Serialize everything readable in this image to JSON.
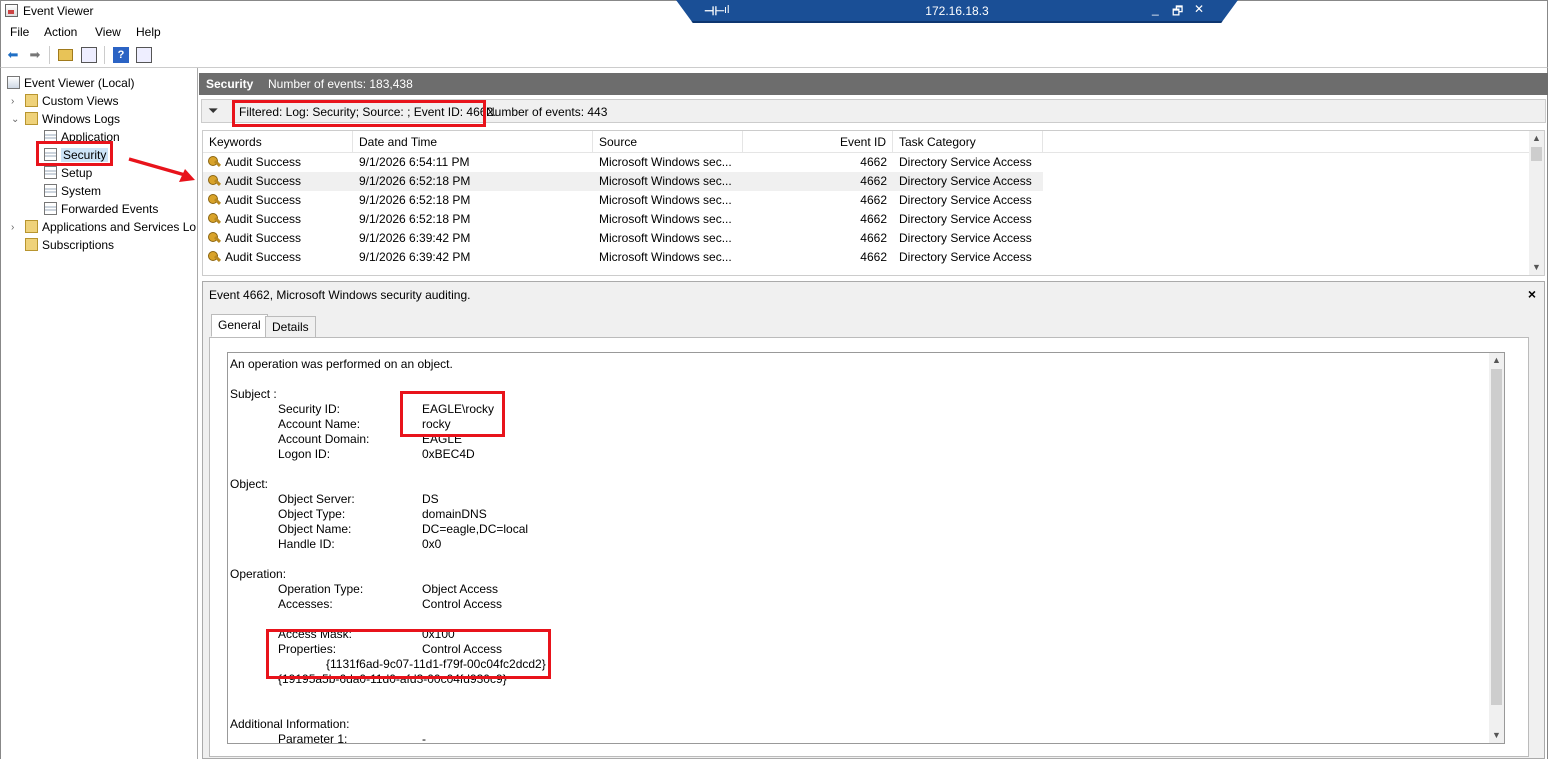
{
  "window": {
    "title": "Event Viewer"
  },
  "rdp": {
    "host": "172.16.18.3",
    "pin": "⊣⊢",
    "signal": "ıl",
    "minimize": "_",
    "restore": "🗗",
    "close": "✕"
  },
  "menu": [
    "File",
    "Action",
    "View",
    "Help"
  ],
  "tree": {
    "root": "Event Viewer (Local)",
    "custom_views": "Custom Views",
    "windows_logs": "Windows Logs",
    "application": "Application",
    "security": "Security",
    "setup": "Setup",
    "system": "System",
    "forwarded": "Forwarded Events",
    "apps_services": "Applications and Services Lo",
    "subscriptions": "Subscriptions"
  },
  "log_header": {
    "title": "Security",
    "count": "Number of events: 183,438"
  },
  "filter": {
    "text": "Filtered: Log: Security; Source: ; Event ID: 4662.",
    "count": "Number of events: 443"
  },
  "grid": {
    "columns": [
      "Keywords",
      "Date and Time",
      "Source",
      "Event ID",
      "Task Category"
    ],
    "rows": [
      [
        "Audit Success",
        "9/1/2026 6:54:11 PM",
        "Microsoft Windows sec...",
        "4662",
        "Directory Service Access"
      ],
      [
        "Audit Success",
        "9/1/2026 6:52:18 PM",
        "Microsoft Windows sec...",
        "4662",
        "Directory Service Access"
      ],
      [
        "Audit Success",
        "9/1/2026 6:52:18 PM",
        "Microsoft Windows sec...",
        "4662",
        "Directory Service Access"
      ],
      [
        "Audit Success",
        "9/1/2026 6:52:18 PM",
        "Microsoft Windows sec...",
        "4662",
        "Directory Service Access"
      ],
      [
        "Audit Success",
        "9/1/2026 6:39:42 PM",
        "Microsoft Windows sec...",
        "4662",
        "Directory Service Access"
      ],
      [
        "Audit Success",
        "9/1/2026 6:39:42 PM",
        "Microsoft Windows sec...",
        "4662",
        "Directory Service Access"
      ]
    ]
  },
  "detail": {
    "title": "Event 4662, Microsoft Windows security auditing.",
    "close": "×",
    "tabs": [
      "General",
      "Details"
    ],
    "intro": "An operation was performed on an object.",
    "subject_h": "Subject :",
    "security_id_k": "Security ID:",
    "security_id_v": "EAGLE\\rocky",
    "account_name_k": "Account Name:",
    "account_name_v": "rocky",
    "account_domain_k": "Account Domain:",
    "account_domain_v": "EAGLE",
    "logon_id_k": "Logon ID:",
    "logon_id_v": "0xBEC4D",
    "object_h": "Object:",
    "object_server_k": "Object Server:",
    "object_server_v": "DS",
    "object_type_k": "Object Type:",
    "object_type_v": "domainDNS",
    "object_name_k": "Object Name:",
    "object_name_v": "DC=eagle,DC=local",
    "handle_id_k": "Handle ID:",
    "handle_id_v": "0x0",
    "operation_h": "Operation:",
    "op_type_k": "Operation Type:",
    "op_type_v": "Object Access",
    "accesses_k": "Accesses:",
    "accesses_v": "Control Access",
    "access_mask_k": "Access Mask:",
    "access_mask_v": "0x100",
    "properties_k": "Properties:",
    "properties_v": "Control Access",
    "guid1": "{1131f6ad-9c07-11d1-f79f-00c04fc2dcd2}",
    "guid2": "{19195a5b-6da0-11d0-afd3-00c04fd930c9}",
    "additional_h": "Additional Information:",
    "param1_k": "Parameter 1:",
    "param1_v": "-"
  },
  "colors": {
    "highlight": "#e8131b",
    "header_strip": "#6d6d6d",
    "rdp_bar": "#1a4f96"
  }
}
